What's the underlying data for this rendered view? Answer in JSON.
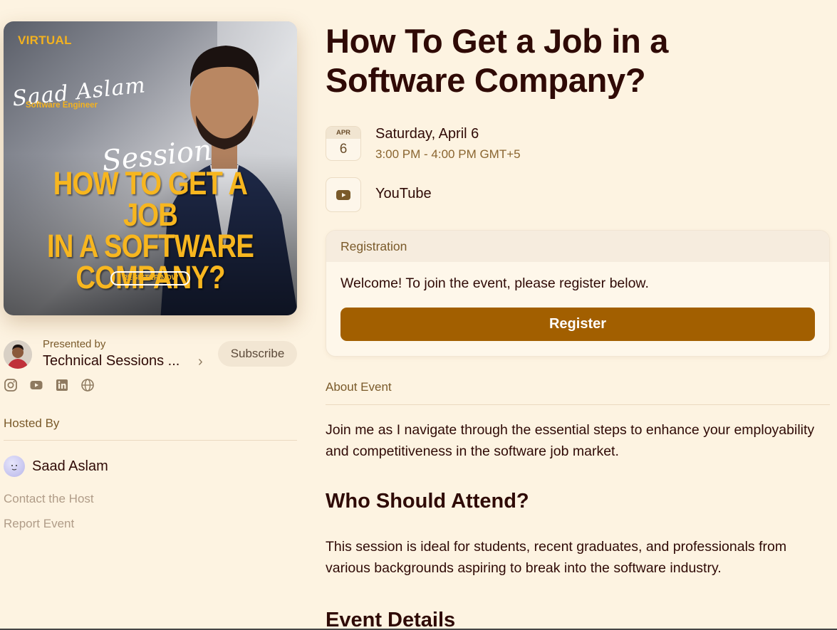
{
  "cover": {
    "tag": "VIRTUAL",
    "signature": "Saad Aslam",
    "role": "Software Engineer",
    "session": "Session",
    "headline": [
      "HOW TO GET A JOB",
      "IN A SOFTWARE",
      "COMPANY?"
    ],
    "register_now": "REGISTER NOW"
  },
  "presenter": {
    "label": "Presented by",
    "name": "Technical Sessions ...",
    "subscribe": "Subscribe",
    "socials": [
      "instagram-icon",
      "youtube-icon",
      "linkedin-icon",
      "globe-icon"
    ]
  },
  "hosted": {
    "title": "Hosted By",
    "host_name": "Saad Aslam",
    "contact": "Contact the Host",
    "report": "Report Event"
  },
  "event": {
    "title": "How To Get a Job in a Software Company?",
    "month": "APR",
    "day_num": "6",
    "day": "Saturday, April 6",
    "time": "3:00 PM - 4:00 PM GMT+5",
    "location": "YouTube"
  },
  "registration": {
    "header": "Registration",
    "welcome": "Welcome! To join the event, please register below.",
    "button": "Register"
  },
  "about": {
    "title": "About Event",
    "intro": "Join me as I navigate through the essential steps to enhance your employability and competitiveness in the software job market.",
    "who_title": "Who Should Attend?",
    "who_text": "This session is ideal for students, recent graduates, and professionals from various backgrounds aspiring to break into the software industry.",
    "details_title": "Event Details"
  },
  "colors": {
    "background": "#fdf3e1",
    "accent": "#a25f00",
    "text": "#2f0a06",
    "muted": "#7a5a2a"
  }
}
